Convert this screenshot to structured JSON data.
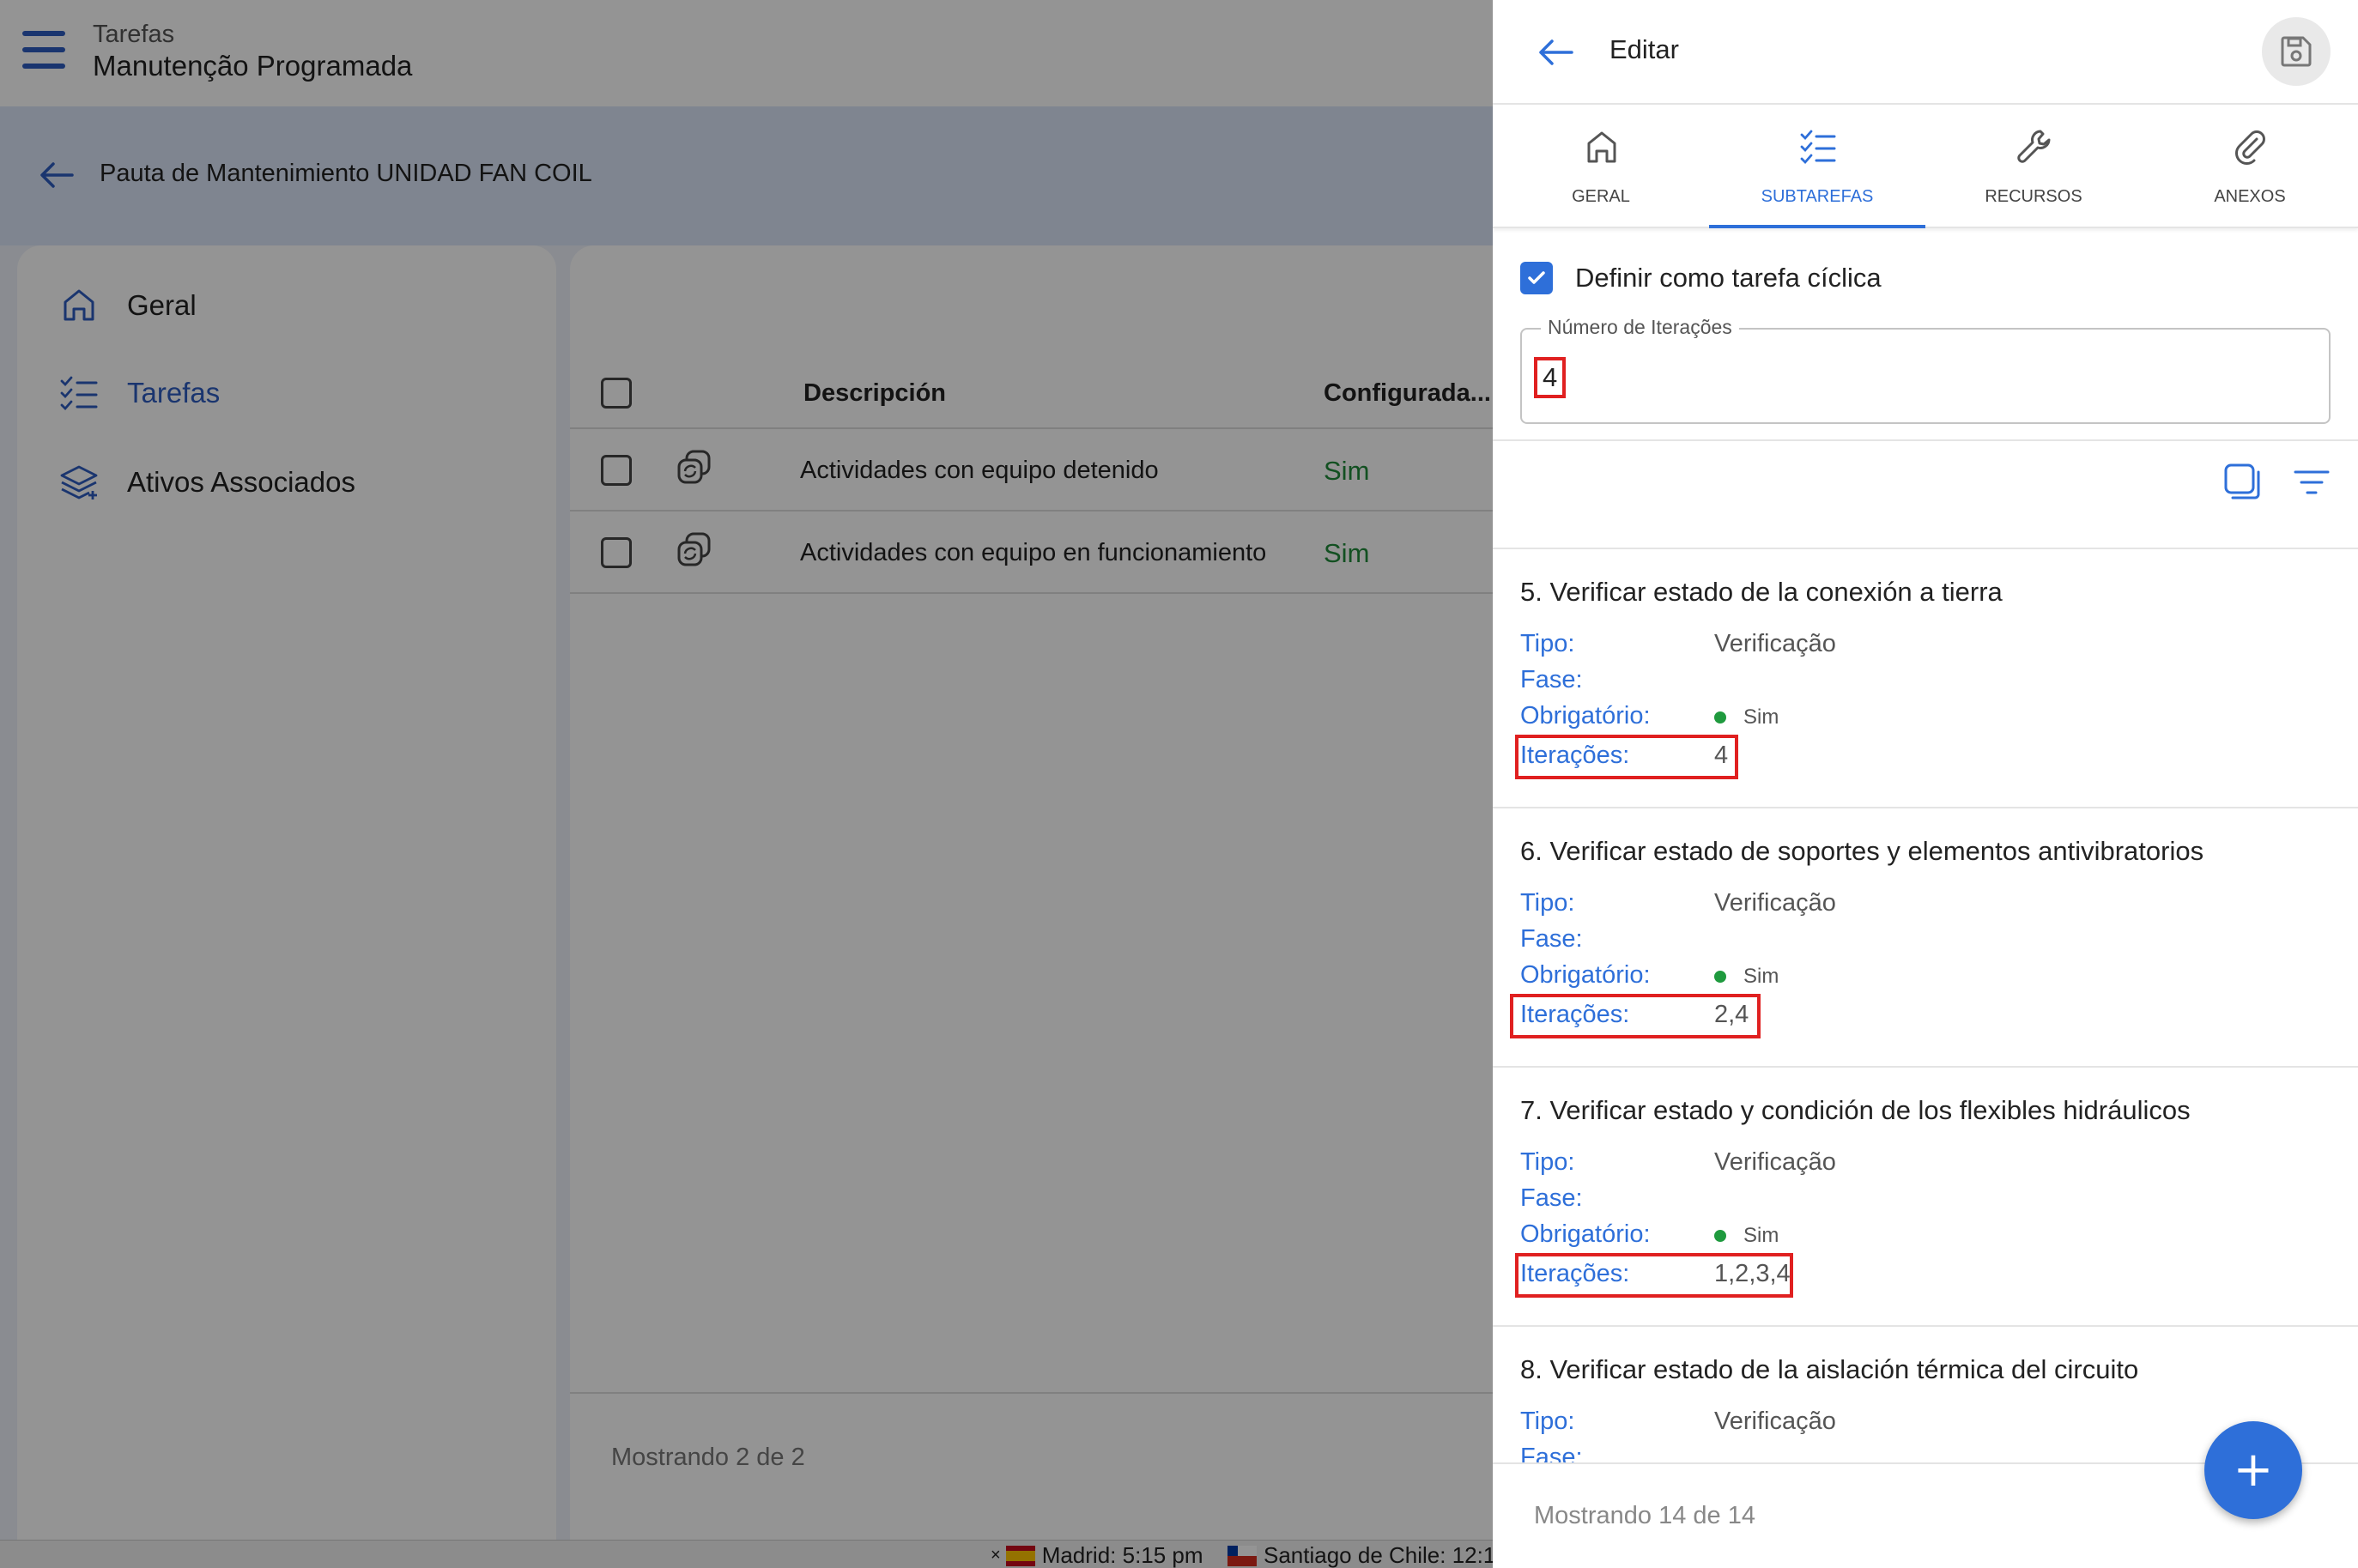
{
  "app": {
    "title": "Tarefas",
    "subtitle": "Manutenção Programada"
  },
  "subheader": {
    "title": "Pauta de Mantenimiento UNIDAD FAN COIL"
  },
  "side_menu": [
    {
      "label": "Geral",
      "icon": "home-icon"
    },
    {
      "label": "Tarefas",
      "icon": "checklist-icon",
      "active": true
    },
    {
      "label": "Ativos Associados",
      "icon": "layers-icon"
    }
  ],
  "table": {
    "columns": [
      "Descripción",
      "Configurada..."
    ],
    "rows": [
      {
        "description": "Actividades con equipo detenido",
        "configured": "Sim"
      },
      {
        "description": "Actividades con equipo en funcionamiento",
        "configured": "Sim"
      }
    ],
    "footer": "Mostrando 2 de 2"
  },
  "status_bar": {
    "clock1": "Madrid: 5:15 pm",
    "clock2": "Santiago de Chile: 12:1",
    "close": "×"
  },
  "drawer": {
    "title": "Editar",
    "tabs": [
      {
        "label": "GERAL",
        "icon": "home-icon"
      },
      {
        "label": "SUBTAREFAS",
        "icon": "checklist-icon",
        "active": true
      },
      {
        "label": "RECURSOS",
        "icon": "wrench-icon"
      },
      {
        "label": "ANEXOS",
        "icon": "paperclip-icon"
      }
    ],
    "cyclic_label": "Definir como tarefa cíclica",
    "iterations_field": {
      "label": "Número de Iterações",
      "value": "4"
    },
    "labels": {
      "tipo": "Tipo:",
      "fase": "Fase:",
      "obrigatorio": "Obrigatório:",
      "iteracoes": "Iterações:"
    },
    "subtasks": [
      {
        "title": "5. Verificar estado de la conexión a tierra",
        "tipo": "Verificação",
        "obrigatorio": "Sim",
        "iteracoes": "4"
      },
      {
        "title": "6. Verificar estado de soportes y elementos antivibratorios",
        "tipo": "Verificação",
        "obrigatorio": "Sim",
        "iteracoes": "2,4"
      },
      {
        "title": "7. Verificar estado y condición de los flexibles hidráulicos",
        "tipo": "Verificação",
        "obrigatorio": "Sim",
        "iteracoes": "1,2,3,4"
      },
      {
        "title": "8. Verificar estado de la aislación térmica del circuito",
        "tipo": "Verificação"
      }
    ],
    "footer": "Mostrando 14 de 14",
    "fab_label": "+"
  },
  "colors": {
    "accent": "#2e6fd9",
    "highlight": "#e02020",
    "success": "#1f9a3e"
  }
}
